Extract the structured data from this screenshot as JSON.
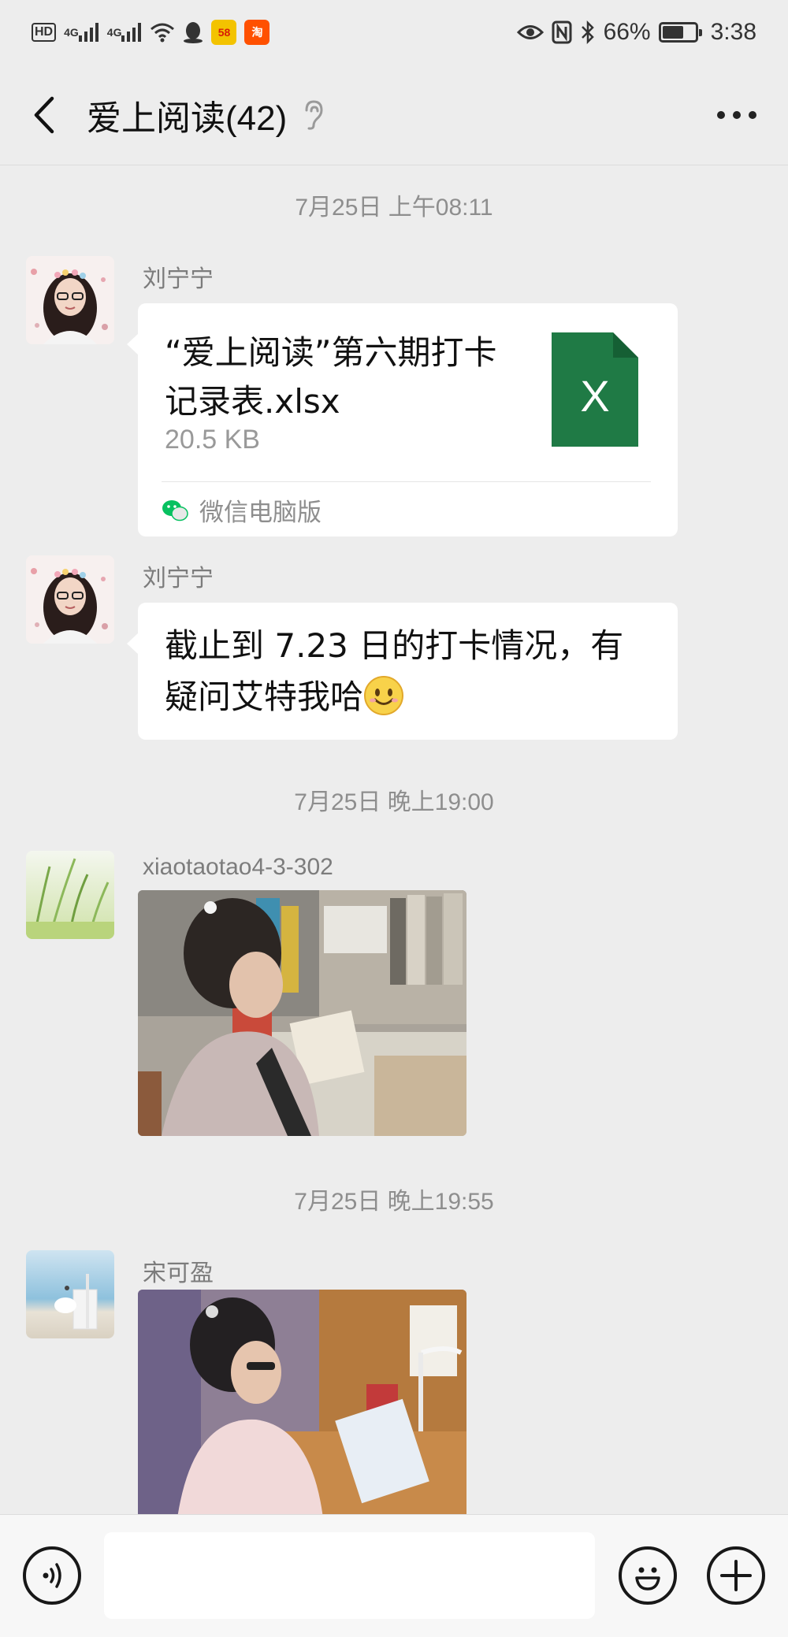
{
  "status_bar": {
    "hd_label": "HD",
    "signal_1": "4G",
    "signal_2": "4G",
    "app_badge_58": "58",
    "app_badge_tao": "淘",
    "battery_pct": "66%",
    "battery_level": 0.66,
    "time": "3:38",
    "icons": [
      "signal-icon",
      "wifi-icon",
      "qq-icon",
      "eye-icon",
      "nfc-icon",
      "bluetooth-icon",
      "battery-icon"
    ]
  },
  "header": {
    "title": "爱上阅读(42)",
    "back_icon": "chevron-left-icon",
    "mute_icon": "ear-icon",
    "more_icon": "more-dots-icon"
  },
  "timestamps": {
    "t1": "7月25日 上午08:11",
    "t2": "7月25日 晚上19:00",
    "t3": "7月25日 晚上19:55"
  },
  "messages": [
    {
      "sender": "刘宁宁",
      "type": "file",
      "file_name": "“爱上阅读”第六期打卡记录表.xlsx",
      "file_size": "20.5 KB",
      "file_icon_letter": "X",
      "source": "微信电脑版"
    },
    {
      "sender": "刘宁宁",
      "type": "text",
      "text": "截止到 7.23 日的打卡情况，有疑问艾特我哈",
      "emoji": "smile-emoji"
    },
    {
      "sender": "xiaotaotao4-3-302",
      "type": "image",
      "image": "girl-reading-at-desk-photo"
    },
    {
      "sender": "宋可盈",
      "type": "image",
      "image": "girl-reading-with-lamp-photo"
    }
  ],
  "input_bar": {
    "placeholder": "",
    "voice_icon": "voice-icon",
    "emoji_icon": "emoji-icon",
    "plus_icon": "plus-icon"
  },
  "colors": {
    "chat_bg": "#ededed",
    "bubble_bg": "#ffffff",
    "excel_green": "#1f7a45",
    "wechat_green": "#07c160"
  }
}
